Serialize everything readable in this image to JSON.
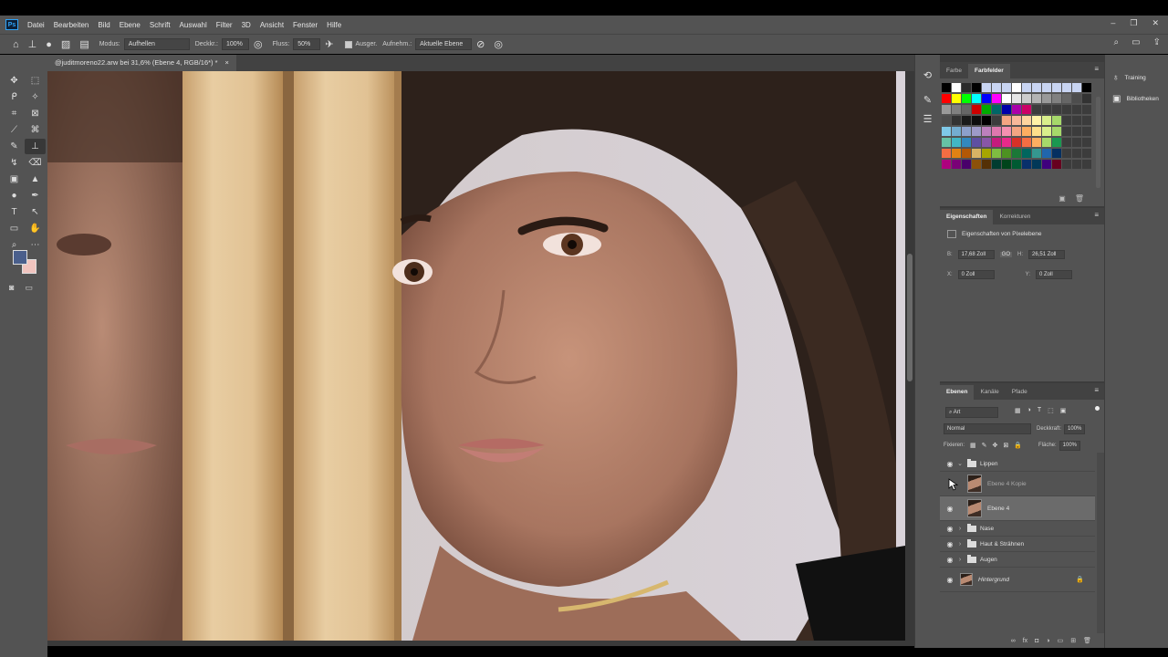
{
  "app": {
    "logo": "Ps",
    "menu": [
      "Datei",
      "Bearbeiten",
      "Bild",
      "Ebene",
      "Schrift",
      "Auswahl",
      "Filter",
      "3D",
      "Ansicht",
      "Fenster",
      "Hilfe"
    ]
  },
  "options": {
    "mode_label": "Modus:",
    "mode_value": "Aufhellen",
    "opacity_label": "Deckkr.:",
    "opacity_value": "100%",
    "flow_label": "Fluss:",
    "flow_value": "50%",
    "aligned_label": "Ausger.",
    "sample_label": "Aufnehm.:",
    "sample_value": "Aktuelle Ebene"
  },
  "document": {
    "tab_title": "@juditmoreno22.arw bei 31,6% (Ebene 4, RGB/16*) *",
    "close": "×"
  },
  "colors": {
    "foreground": "#4a5f8c",
    "background": "#f1c4bf"
  },
  "swatches_panel": {
    "tabs": [
      "Farbe",
      "Farbfelder"
    ],
    "active_tab": "Farbfelder"
  },
  "properties_panel": {
    "tabs": [
      "Eigenschaften",
      "Korrekturen"
    ],
    "title": "Eigenschaften von Pixelebene",
    "w_label": "B:",
    "w_value": "17,68 Zoll",
    "link_label": "GO",
    "h_label": "H:",
    "h_value": "26,51 Zoll",
    "x_label": "X:",
    "x_value": "0 Zoll",
    "y_label": "Y:",
    "y_value": "0 Zoll"
  },
  "layers_panel": {
    "tabs": [
      "Ebenen",
      "Kanäle",
      "Pfade"
    ],
    "search_label": "Art",
    "blend_mode": "Normal",
    "opacity_label": "Deckkraft:",
    "opacity_value": "100%",
    "lock_label": "Fixieren:",
    "fill_label": "Fläche:",
    "fill_value": "100%",
    "layers": [
      {
        "name": "Lippen",
        "type": "group",
        "expanded": true
      },
      {
        "name": "Ebene 4 Kopie",
        "type": "pixel",
        "visible": false
      },
      {
        "name": "Ebene 4",
        "type": "pixel",
        "selected": true
      },
      {
        "name": "Nase",
        "type": "group"
      },
      {
        "name": "Haut & Strähnen",
        "type": "group"
      },
      {
        "name": "Augen",
        "type": "group"
      },
      {
        "name": "Hintergrund",
        "type": "background",
        "locked": true
      }
    ]
  },
  "right_dock": {
    "items": [
      "Training",
      "Bibliotheken"
    ]
  }
}
